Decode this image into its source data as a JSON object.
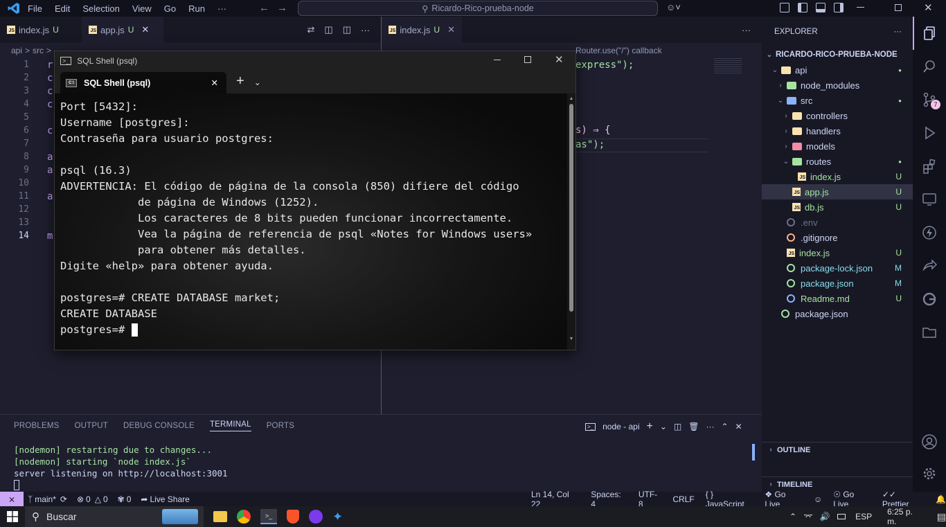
{
  "titlebar": {
    "menu": [
      "File",
      "Edit",
      "Selection",
      "View",
      "Go",
      "Run",
      "···"
    ],
    "search": "Ricardo-Rico-prueba-node"
  },
  "editor_left": {
    "tabs": [
      {
        "name": "index.js",
        "status": "U"
      },
      {
        "name": "app.js",
        "status": "U"
      }
    ],
    "breadcrumb": [
      "api",
      ">",
      "src",
      ">"
    ],
    "line_numbers": [
      "1",
      "2",
      "3",
      "4",
      "5",
      "6",
      "7",
      "8",
      "9",
      "10",
      "11",
      "12",
      "13",
      "14"
    ],
    "code_fragments": [
      "r",
      "c",
      "c",
      "c",
      "",
      "c",
      "",
      "a",
      "a",
      "",
      "a",
      "",
      "",
      "m"
    ]
  },
  "editor_right": {
    "tab": {
      "name": "index.js",
      "status": "U"
    },
    "breadcrumb_tail": "Router.use(\"/\") callback",
    "code": [
      "express\");",
      "s) ⇒ {",
      "as\");"
    ]
  },
  "explorer": {
    "title": "EXPLORER",
    "root": "RICARDO-RICO-PRUEBA-NODE",
    "items": [
      {
        "label": "api",
        "level": 1,
        "kind": "folder-open",
        "color": "#f9e2af",
        "status": "●"
      },
      {
        "label": "node_modules",
        "level": 2,
        "kind": "folder",
        "color": "#a6e3a1",
        "status": ""
      },
      {
        "label": "src",
        "level": 2,
        "kind": "folder-open",
        "color": "#89b4fa",
        "status": "●"
      },
      {
        "label": "controllers",
        "level": 3,
        "kind": "folder",
        "color": "#f9e2af",
        "status": ""
      },
      {
        "label": "handlers",
        "level": 3,
        "kind": "folder",
        "color": "#f9e2af",
        "status": ""
      },
      {
        "label": "models",
        "level": 3,
        "kind": "folder",
        "color": "#f38ba8",
        "status": ""
      },
      {
        "label": "routes",
        "level": 3,
        "kind": "folder-open",
        "color": "#a6e3a1",
        "status": "●"
      },
      {
        "label": "index.js",
        "level": 4,
        "kind": "js",
        "color": "#f9e2af",
        "status": "U"
      },
      {
        "label": "app.js",
        "level": 3,
        "kind": "js",
        "color": "#f9e2af",
        "status": "U"
      },
      {
        "label": "db.js",
        "level": 3,
        "kind": "js",
        "color": "#f9e2af",
        "status": "U"
      },
      {
        "label": ".env",
        "level": 2,
        "kind": "env",
        "color": "#6c7086",
        "status": ""
      },
      {
        "label": ".gitignore",
        "level": 2,
        "kind": "git",
        "color": "#fab387",
        "status": ""
      },
      {
        "label": "index.js",
        "level": 2,
        "kind": "js",
        "color": "#f9e2af",
        "status": "U"
      },
      {
        "label": "package-lock.json",
        "level": 2,
        "kind": "node",
        "color": "#a6e3a1",
        "status": "M"
      },
      {
        "label": "package.json",
        "level": 2,
        "kind": "node",
        "color": "#a6e3a1",
        "status": "M"
      },
      {
        "label": "Readme.md",
        "level": 2,
        "kind": "info",
        "color": "#89b4fa",
        "status": "U"
      },
      {
        "label": "package.json",
        "level": 1,
        "kind": "node",
        "color": "#a6e3a1",
        "status": ""
      }
    ],
    "outline": "OUTLINE",
    "timeline": "TIMELINE"
  },
  "activity": {
    "scm_badge": "7"
  },
  "panel": {
    "tabs": [
      "PROBLEMS",
      "OUTPUT",
      "DEBUG CONSOLE",
      "TERMINAL",
      "PORTS"
    ],
    "terminal_name": "node - api",
    "lines": [
      {
        "text": "[nodemon] restarting due to changes...",
        "color": "#a6e3a1"
      },
      {
        "text": "[nodemon] starting `node index.js`",
        "color": "#a6e3a1"
      },
      {
        "text": "server listening on http://localhost:3001",
        "color": "#cdd6f4"
      }
    ]
  },
  "statusbar": {
    "branch": "main*",
    "errors": "0",
    "warnings": "0",
    "ports": "0",
    "liveshare": "Live Share",
    "position": "Ln 14, Col 22",
    "spaces": "Spaces: 4",
    "encoding": "UTF-8",
    "eol": "CRLF",
    "language": "JavaScript",
    "golive1": "Go Live",
    "golive2": "Go Live",
    "prettier": "Prettier"
  },
  "shell": {
    "window_title": "SQL Shell (psql)",
    "tab_title": "SQL Shell (psql)",
    "lines": [
      "Port [5432]:",
      "Username [postgres]:",
      "Contraseña para usuario postgres:",
      "",
      "psql (16.3)",
      "ADVERTENCIA: El código de página de la consola (850) difiere del código",
      "            de página de Windows (1252).",
      "            Los caracteres de 8 bits pueden funcionar incorrectamente.",
      "            Vea la página de referencia de psql «Notes for Windows users»",
      "            para obtener más detalles.",
      "Digite «help» para obtener ayuda.",
      "",
      "postgres=# CREATE DATABASE market;",
      "CREATE DATABASE",
      "postgres=# "
    ]
  },
  "taskbar": {
    "search_placeholder": "Buscar",
    "lang": "ESP",
    "time": "6:25 p. m."
  }
}
